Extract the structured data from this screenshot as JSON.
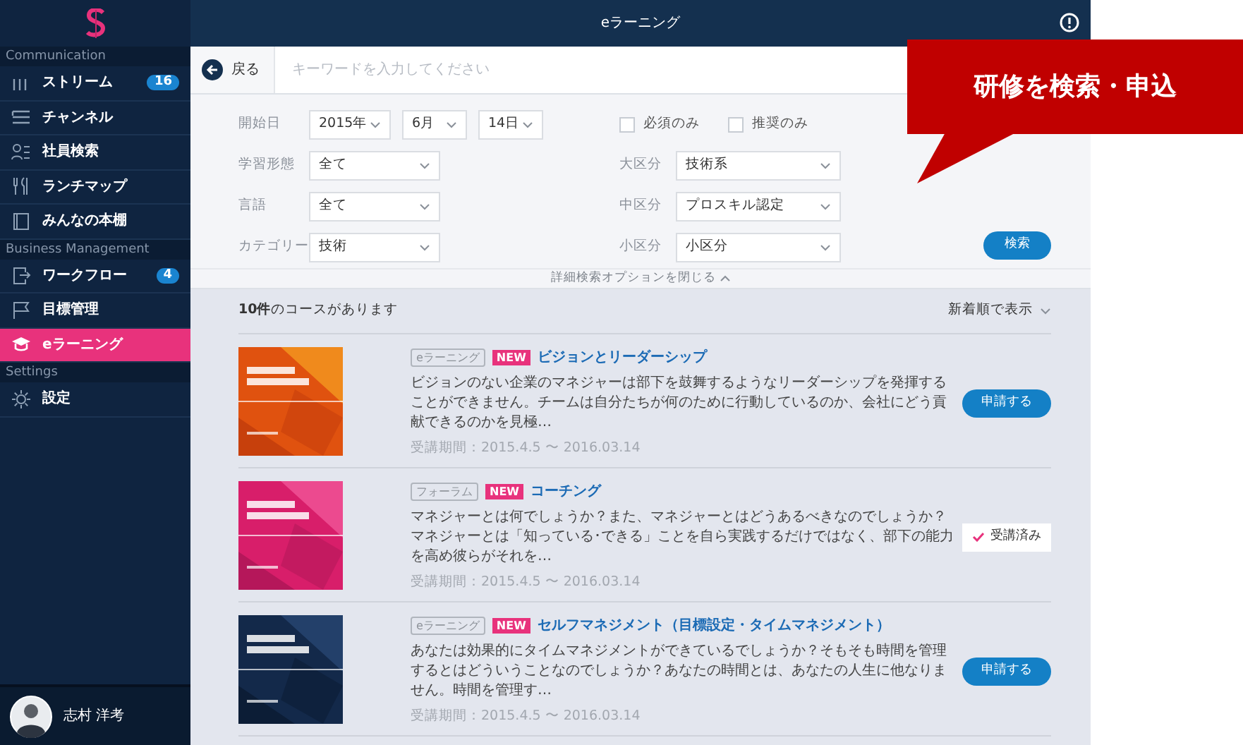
{
  "window": {
    "title": "eラーニング"
  },
  "sidebar": {
    "sections": [
      {
        "title": "Communication",
        "items": [
          {
            "label": "ストリーム",
            "badge": "16",
            "selected": false
          },
          {
            "label": "チャンネル",
            "selected": false
          },
          {
            "label": "社員検索",
            "selected": false
          },
          {
            "label": "ランチマップ",
            "selected": false
          },
          {
            "label": "みんなの本棚",
            "selected": false
          }
        ]
      },
      {
        "title": "Business Management",
        "items": [
          {
            "label": "ワークフロー",
            "badge": "4",
            "selected": false
          },
          {
            "label": "目標管理",
            "selected": false
          },
          {
            "label": "eラーニング",
            "selected": true
          }
        ]
      },
      {
        "title": "Settings",
        "items": [
          {
            "label": "設定",
            "selected": false
          }
        ]
      }
    ],
    "user": {
      "name": "志村 洋考"
    }
  },
  "search": {
    "back": "戻る",
    "placeholder": "キーワードを入力してください"
  },
  "filters": {
    "date": {
      "label": "開始日",
      "year": "2015年",
      "month": "6月",
      "day": "14日"
    },
    "left": [
      {
        "label": "学習形態",
        "value": "全て"
      },
      {
        "label": "言語",
        "value": "全て"
      },
      {
        "label": "カテゴリー",
        "value": "技術"
      }
    ],
    "checkboxes": [
      {
        "label": "必須のみ",
        "checked": false
      },
      {
        "label": "推奨のみ",
        "checked": false
      }
    ],
    "right": [
      {
        "label": "大区分",
        "value": "技術系"
      },
      {
        "label": "中区分",
        "value": "プロスキル認定"
      },
      {
        "label": "小区分",
        "value": "小区分"
      }
    ],
    "search_button": "検索",
    "toggle": "詳細検索オプションを閉じる"
  },
  "results": {
    "count": "**10件**のコースがあります",
    "sort": "新着順で表示",
    "courses": [
      {
        "tag": "eラーニング",
        "new": "NEW",
        "title": "ビジョンとリーダーシップ",
        "description": "ビジョンのない企業のマネジャーは部下を鼓舞するようなリーダーシップを発揮することができません。チームは自分たちが何のために行動しているのか、会社にどう貢献できるのかを見極…",
        "period": "受講期間：2015.4.5 〜 2016.03.14",
        "action": {
          "kind": "apply",
          "label": "申請する"
        }
      },
      {
        "tag": "フォーラム",
        "new": "NEW",
        "title": "コーチング",
        "description": "マネジャーとは何でしょうか？また、マネジャーとはどうあるべきなのでしょうか？マネジャーとは「知っている･できる」ことを自ら実践するだけではなく、部下の能力を高め彼らがそれを…",
        "period": "受講期間：2015.4.5 〜 2016.03.14",
        "action": {
          "kind": "done",
          "label": "受講済み"
        }
      },
      {
        "tag": "eラーニング",
        "new": "NEW",
        "title": "セルフマネジメント（目標設定・タイムマネジメント）",
        "description": "あなたは効果的にタイムマネジメントができているでしょうか？そもそも時間を管理するとはどういうことなのでしょうか？あなたの時間とは、あなたの人生に他なりません。時間を管理す…",
        "period": "受講期間：2015.4.5 〜 2016.03.14",
        "action": {
          "kind": "apply",
          "label": "申請する"
        }
      }
    ]
  },
  "callout": {
    "text": "研修を検索・申込"
  }
}
